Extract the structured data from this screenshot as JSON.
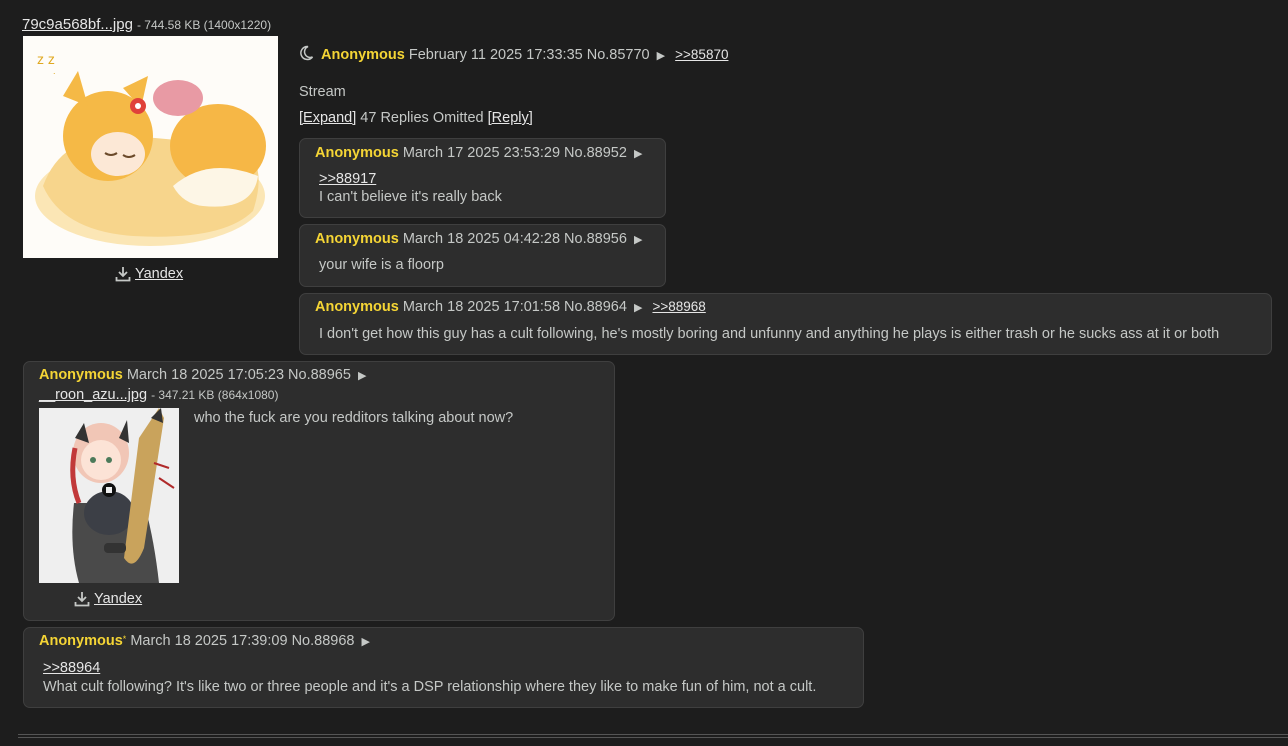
{
  "op": {
    "file_name": "79c9a568bf...jpg",
    "file_size": "- 744.58 KB (1400x1220)",
    "yandex": "Yandex",
    "name": "Anonymous",
    "date": "February 11 2025 17:33:35",
    "no": "No.85770",
    "backlink": ">>85870",
    "text": "Stream",
    "expand": "[Expand]",
    "omitted": "47 Replies Omitted",
    "reply_link": "[Reply]"
  },
  "replies": [
    {
      "name": "Anonymous",
      "date": "March 17 2025 23:53:29",
      "no": "No.88952",
      "quote": ">>88917",
      "text": "I can't believe it's really back"
    },
    {
      "name": "Anonymous",
      "date": "March 18 2025 04:42:28",
      "no": "No.88956",
      "text": "your wife is a floorp"
    },
    {
      "name": "Anonymous",
      "date": "March 18 2025 17:01:58",
      "no": "No.88964",
      "backlink": ">>88968",
      "text": "I don't get how this guy has a cult following, he's mostly boring and unfunny and anything he plays is either trash or he sucks ass at it or both"
    },
    {
      "name": "Anonymous",
      "date": "March 18 2025 17:05:23",
      "no": "No.88965",
      "file_name": "__roon_azu...jpg",
      "file_size": "- 347.21 KB (864x1080)",
      "yandex": "Yandex",
      "text": "who the fuck are you redditors talking about now?"
    },
    {
      "name": "Anonymous",
      "date": "March 18 2025 17:39:09",
      "no": "No.88968",
      "quote": ">>88964",
      "text": "What cult following? It's like two or three people and it's a DSP relationship where they like to make fun of him, not a cult."
    }
  ],
  "icons": {
    "moon": "crescent-moon-icon",
    "download": "download-icon",
    "arrow": "triangle-right-icon"
  }
}
